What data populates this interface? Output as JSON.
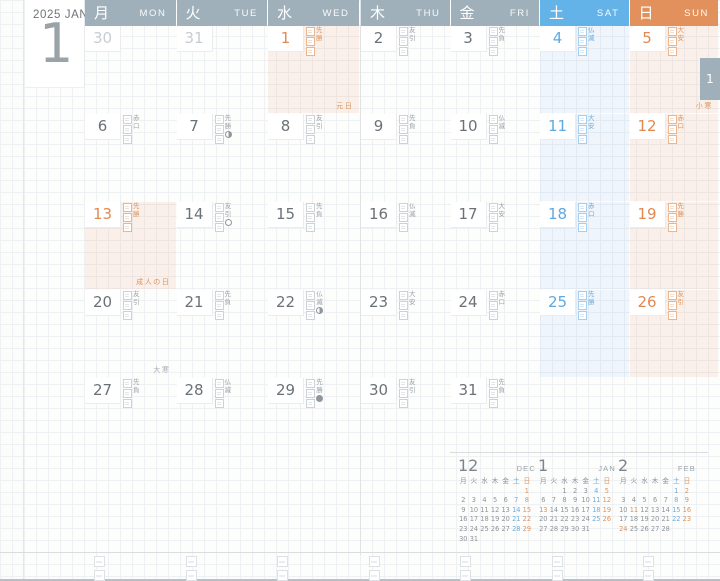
{
  "page": {
    "year_month_label": "2025  JAN",
    "big_month": "1",
    "edge_tab": "1"
  },
  "weekdays": [
    {
      "jp": "月",
      "en": "MON",
      "kind": "gray"
    },
    {
      "jp": "火",
      "en": "TUE",
      "kind": "gray"
    },
    {
      "jp": "水",
      "en": "WED",
      "kind": "gray"
    },
    {
      "jp": "木",
      "en": "THU",
      "kind": "gray"
    },
    {
      "jp": "金",
      "en": "FRI",
      "kind": "gray"
    },
    {
      "jp": "土",
      "en": "SAT",
      "kind": "sat"
    },
    {
      "jp": "日",
      "en": "SUN",
      "kind": "sun"
    }
  ],
  "days": [
    {
      "n": "30",
      "col": 0,
      "row": 0,
      "tone": "out",
      "roku": "",
      "moon": "",
      "note": ""
    },
    {
      "n": "31",
      "col": 1,
      "row": 0,
      "tone": "out",
      "roku": "",
      "moon": "",
      "note": ""
    },
    {
      "n": "1",
      "col": 2,
      "row": 0,
      "tone": "hol",
      "roku": "先勝",
      "moon": "",
      "note": "元日"
    },
    {
      "n": "2",
      "col": 3,
      "row": 0,
      "tone": "",
      "roku": "友引",
      "moon": "",
      "note": ""
    },
    {
      "n": "3",
      "col": 4,
      "row": 0,
      "tone": "",
      "roku": "先負",
      "moon": "",
      "note": ""
    },
    {
      "n": "4",
      "col": 5,
      "row": 0,
      "tone": "sat",
      "roku": "仏滅",
      "moon": "",
      "note": ""
    },
    {
      "n": "5",
      "col": 6,
      "row": 0,
      "tone": "sun",
      "roku": "大安",
      "moon": "",
      "note": "小寒"
    },
    {
      "n": "6",
      "col": 0,
      "row": 1,
      "tone": "",
      "roku": "赤口",
      "moon": "",
      "note": ""
    },
    {
      "n": "7",
      "col": 1,
      "row": 1,
      "tone": "",
      "roku": "先勝",
      "moon": "half",
      "note": ""
    },
    {
      "n": "8",
      "col": 2,
      "row": 1,
      "tone": "",
      "roku": "友引",
      "moon": "",
      "note": ""
    },
    {
      "n": "9",
      "col": 3,
      "row": 1,
      "tone": "",
      "roku": "先負",
      "moon": "",
      "note": ""
    },
    {
      "n": "10",
      "col": 4,
      "row": 1,
      "tone": "",
      "roku": "仏滅",
      "moon": "",
      "note": ""
    },
    {
      "n": "11",
      "col": 5,
      "row": 1,
      "tone": "sat",
      "roku": "大安",
      "moon": "",
      "note": ""
    },
    {
      "n": "12",
      "col": 6,
      "row": 1,
      "tone": "sun",
      "roku": "赤口",
      "moon": "",
      "note": ""
    },
    {
      "n": "13",
      "col": 0,
      "row": 2,
      "tone": "hol",
      "roku": "先勝",
      "moon": "",
      "note": "成人の日"
    },
    {
      "n": "14",
      "col": 1,
      "row": 2,
      "tone": "",
      "roku": "友引",
      "moon": "full",
      "note": ""
    },
    {
      "n": "15",
      "col": 2,
      "row": 2,
      "tone": "",
      "roku": "先負",
      "moon": "",
      "note": ""
    },
    {
      "n": "16",
      "col": 3,
      "row": 2,
      "tone": "",
      "roku": "仏滅",
      "moon": "",
      "note": ""
    },
    {
      "n": "17",
      "col": 4,
      "row": 2,
      "tone": "",
      "roku": "大安",
      "moon": "",
      "note": ""
    },
    {
      "n": "18",
      "col": 5,
      "row": 2,
      "tone": "sat",
      "roku": "赤口",
      "moon": "",
      "note": ""
    },
    {
      "n": "19",
      "col": 6,
      "row": 2,
      "tone": "sun",
      "roku": "先勝",
      "moon": "",
      "note": ""
    },
    {
      "n": "20",
      "col": 0,
      "row": 3,
      "tone": "",
      "roku": "友引",
      "moon": "",
      "note": "大寒"
    },
    {
      "n": "21",
      "col": 1,
      "row": 3,
      "tone": "",
      "roku": "先負",
      "moon": "",
      "note": ""
    },
    {
      "n": "22",
      "col": 2,
      "row": 3,
      "tone": "",
      "roku": "仏滅",
      "moon": "half",
      "note": ""
    },
    {
      "n": "23",
      "col": 3,
      "row": 3,
      "tone": "",
      "roku": "大安",
      "moon": "",
      "note": ""
    },
    {
      "n": "24",
      "col": 4,
      "row": 3,
      "tone": "",
      "roku": "赤口",
      "moon": "",
      "note": ""
    },
    {
      "n": "25",
      "col": 5,
      "row": 3,
      "tone": "sat",
      "roku": "先勝",
      "moon": "",
      "note": ""
    },
    {
      "n": "26",
      "col": 6,
      "row": 3,
      "tone": "sun",
      "roku": "友引",
      "moon": "",
      "note": ""
    },
    {
      "n": "27",
      "col": 0,
      "row": 4,
      "tone": "",
      "roku": "先負",
      "moon": "",
      "note": ""
    },
    {
      "n": "28",
      "col": 1,
      "row": 4,
      "tone": "",
      "roku": "仏滅",
      "moon": "",
      "note": ""
    },
    {
      "n": "29",
      "col": 2,
      "row": 4,
      "tone": "",
      "roku": "先勝",
      "moon": "new",
      "note": ""
    },
    {
      "n": "30",
      "col": 3,
      "row": 4,
      "tone": "",
      "roku": "友引",
      "moon": "",
      "note": ""
    },
    {
      "n": "31",
      "col": 4,
      "row": 4,
      "tone": "",
      "roku": "先負",
      "moon": "",
      "note": ""
    }
  ],
  "mini_calendars": [
    {
      "num": "12",
      "en": "DEC",
      "dow": [
        "月",
        "火",
        "水",
        "木",
        "金",
        "土",
        "日"
      ],
      "weeks": [
        [
          "",
          "",
          "",
          "",
          "",
          "",
          "1"
        ],
        [
          "2",
          "3",
          "4",
          "5",
          "6",
          "7",
          "8"
        ],
        [
          "9",
          "10",
          "11",
          "12",
          "13",
          "14",
          "15"
        ],
        [
          "16",
          "17",
          "18",
          "19",
          "20",
          "21",
          "22"
        ],
        [
          "23",
          "24",
          "25",
          "26",
          "27",
          "28",
          "29"
        ],
        [
          "30",
          "31",
          "",
          "",
          "",
          "",
          ""
        ]
      ],
      "holidays": []
    },
    {
      "num": "1",
      "en": "JAN",
      "dow": [
        "月",
        "火",
        "水",
        "木",
        "金",
        "土",
        "日"
      ],
      "weeks": [
        [
          "",
          "",
          "1",
          "2",
          "3",
          "4",
          "5"
        ],
        [
          "6",
          "7",
          "8",
          "9",
          "10",
          "11",
          "12"
        ],
        [
          "13",
          "14",
          "15",
          "16",
          "17",
          "18",
          "19"
        ],
        [
          "20",
          "21",
          "22",
          "23",
          "24",
          "25",
          "26"
        ],
        [
          "27",
          "28",
          "29",
          "30",
          "31",
          "",
          ""
        ]
      ],
      "holidays": [
        "13"
      ]
    },
    {
      "num": "2",
      "en": "FEB",
      "dow": [
        "月",
        "火",
        "水",
        "木",
        "金",
        "土",
        "日"
      ],
      "weeks": [
        [
          "",
          "",
          "",
          "",
          "",
          "1",
          "2"
        ],
        [
          "3",
          "4",
          "5",
          "6",
          "7",
          "8",
          "9"
        ],
        [
          "10",
          "11",
          "12",
          "13",
          "14",
          "15",
          "16"
        ],
        [
          "17",
          "18",
          "19",
          "20",
          "21",
          "22",
          "23"
        ],
        [
          "24",
          "25",
          "26",
          "27",
          "28",
          "",
          ""
        ]
      ],
      "holidays": [
        "11",
        "24"
      ]
    }
  ],
  "colors": {
    "sunday": "#e3915c",
    "saturday": "#64b3e8",
    "weekday_header": "#9fb0ba",
    "text": "#6b7277"
  }
}
